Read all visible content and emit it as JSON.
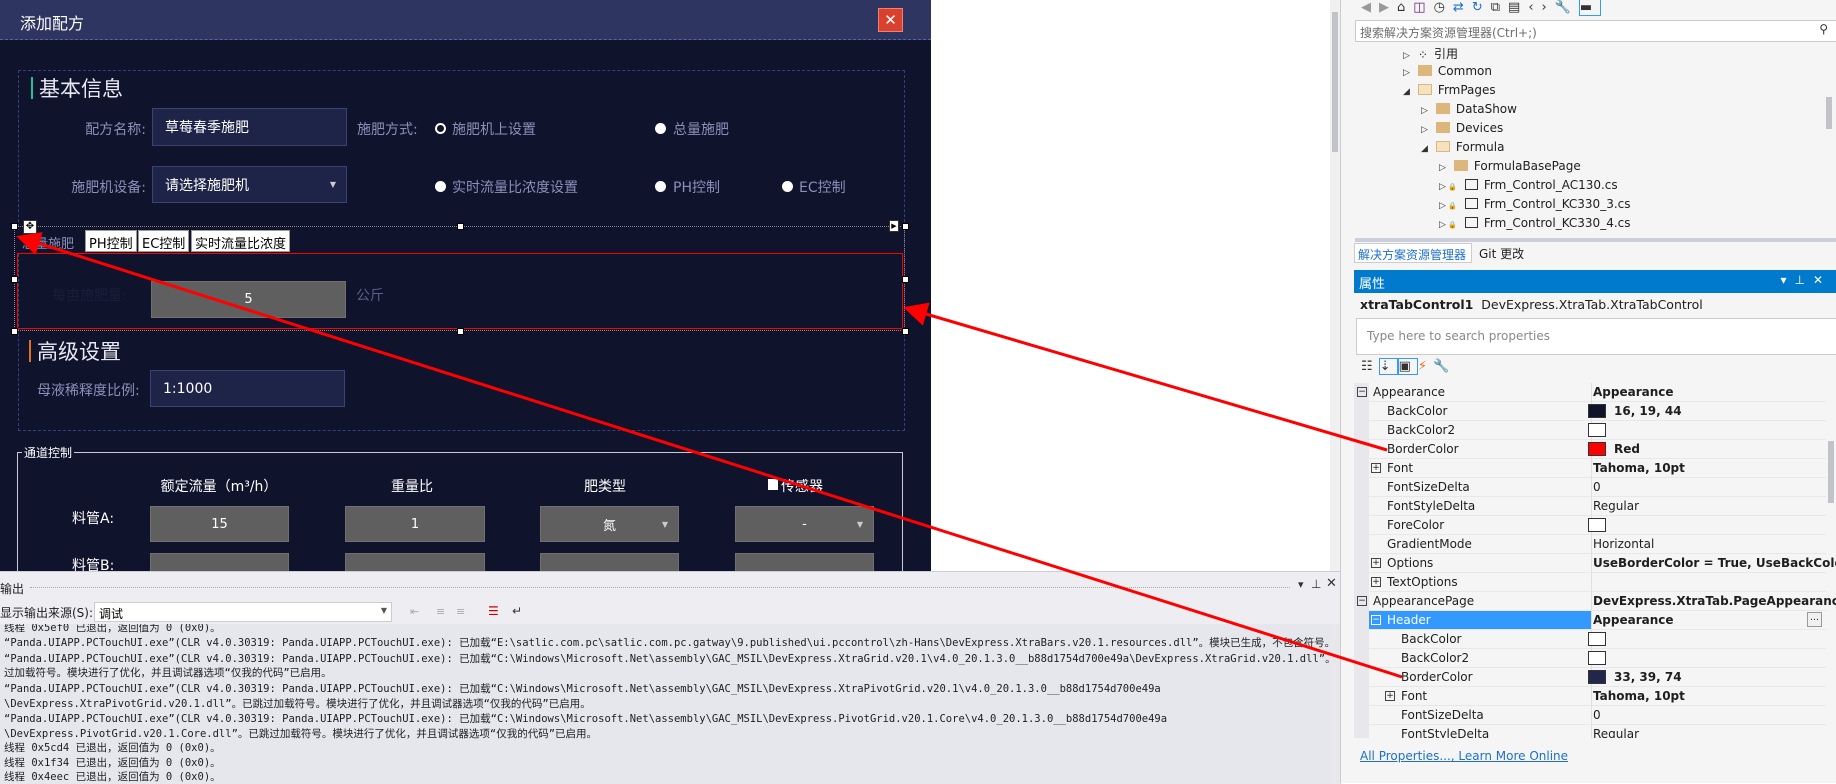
{
  "dialog": {
    "title": "添加配方",
    "close_icon": "close-icon",
    "basic_section": "基本信息",
    "recipe_name_label": "配方名称:",
    "recipe_name_value": "草莓春季施肥",
    "method_label": "施肥方式:",
    "method_options": [
      {
        "label": "施肥机上设置",
        "selected": true
      },
      {
        "label": "总量施肥",
        "selected": false
      }
    ],
    "device_label": "施肥机设备:",
    "device_value": "请选择施肥机",
    "control_options": [
      {
        "label": "实时流量比浓度设置"
      },
      {
        "label": "PH控制"
      },
      {
        "label": "EC控制"
      }
    ],
    "tabs": [
      "总量施肥",
      "PH控制",
      "EC控制",
      "实时流量比浓度"
    ],
    "per_mu_label": "每亩施肥量:",
    "per_mu_value": "5",
    "per_mu_unit": "公斤",
    "advanced_section": "高级设置",
    "dilution_label": "母液稀释度比例:",
    "dilution_value": "1:1000",
    "channel_group": "通道控制",
    "columns": [
      "额定流量（m³/h）",
      "重量比",
      "肥类型",
      "传感器"
    ],
    "rows": [
      {
        "label": "料管A:",
        "flow": "15",
        "ratio": "1",
        "type": "氮",
        "sensor": "-"
      },
      {
        "label": "料管B:"
      }
    ],
    "colors": {
      "background": "#10132c",
      "titlebar": "#2e3560",
      "tab_border": "#ff0000"
    }
  },
  "output": {
    "title": "输出",
    "source_label": "显示输出来源(S):",
    "source_value": "调试",
    "lines": [
      "线程 0x5ef0 已退出，返回值为 0 (0x0)。",
      "“Panda.UIAPP.PCTouchUI.exe”(CLR v4.0.30319: Panda.UIAPP.PCTouchUI.exe): 已加载“E:\\satlic.com.pc\\satlic.com.pc.gatway\\9.published\\ui.pccontrol\\zh-Hans\\DevExpress.XtraBars.v20.1.resources.dll”。模块已生成，不包含符号。",
      "“Panda.UIAPP.PCTouchUI.exe”(CLR v4.0.30319: Panda.UIAPP.PCTouchUI.exe): 已加载“C:\\Windows\\Microsoft.Net\\assembly\\GAC_MSIL\\DevExpress.XtraGrid.v20.1\\v4.0_20.1.3.0__b88d1754d700e49a\\DevExpress.XtraGrid.v20.1.dll”。已跳",
      "  过加载符号。模块进行了优化，并且调试器选项“仅我的代码”已启用。",
      "“Panda.UIAPP.PCTouchUI.exe”(CLR v4.0.30319: Panda.UIAPP.PCTouchUI.exe): 已加载“C:\\Windows\\Microsoft.Net\\assembly\\GAC_MSIL\\DevExpress.XtraPivotGrid.v20.1\\v4.0_20.1.3.0__b88d1754d700e49a",
      "  \\DevExpress.XtraPivotGrid.v20.1.dll”。已跳过加载符号。模块进行了优化，并且调试器选项“仅我的代码”已启用。",
      "“Panda.UIAPP.PCTouchUI.exe”(CLR v4.0.30319: Panda.UIAPP.PCTouchUI.exe): 已加载“C:\\Windows\\Microsoft.Net\\assembly\\GAC_MSIL\\DevExpress.PivotGrid.v20.1.Core\\v4.0_20.1.3.0__b88d1754d700e49a",
      "  \\DevExpress.PivotGrid.v20.1.Core.dll”。已跳过加载符号。模块进行了优化，并且调试器选项“仅我的代码”已启用。",
      "线程 0x5cd4 已退出，返回值为 0 (0x0)。",
      "线程 0x1f34 已退出，返回值为 0 (0x0)。",
      "线程 0x4eec 已退出，返回值为 0 (0x0)。"
    ]
  },
  "solution": {
    "search_placeholder": "搜索解决方案资源管理器(Ctrl+;)",
    "items": [
      {
        "label": "引用",
        "level": 1,
        "expanded": false,
        "icon": "references-icon"
      },
      {
        "label": "Common",
        "level": 1,
        "expanded": false,
        "icon": "folder-icon"
      },
      {
        "label": "FrmPages",
        "level": 1,
        "expanded": true,
        "icon": "folder-open-icon"
      },
      {
        "label": "DataShow",
        "level": 2,
        "expanded": false,
        "icon": "folder-icon"
      },
      {
        "label": "Devices",
        "level": 2,
        "expanded": false,
        "icon": "folder-icon"
      },
      {
        "label": "Formula",
        "level": 2,
        "expanded": true,
        "icon": "folder-open-icon"
      },
      {
        "label": "FormulaBasePage",
        "level": 3,
        "expanded": false,
        "icon": "folder-icon"
      },
      {
        "label": "Frm_Control_AC130.cs",
        "level": 3,
        "expanded": false,
        "icon": "form-icon"
      },
      {
        "label": "Frm_Control_KC330_3.cs",
        "level": 3,
        "expanded": false,
        "icon": "form-icon"
      },
      {
        "label": "Frm_Control_KC330_4.cs",
        "level": 3,
        "expanded": false,
        "icon": "form-icon"
      }
    ],
    "tabs": [
      "解决方案资源管理器",
      "Git 更改"
    ]
  },
  "properties": {
    "title": "属性",
    "object_name": "xtraTabControl1",
    "object_type": "DevExpress.XtraTab.XtraTabControl",
    "search_placeholder": "Type here to search properties",
    "rows": [
      {
        "name": "Appearance",
        "value": "Appearance",
        "level": 0,
        "expander": "minus",
        "bold": true
      },
      {
        "name": "BackColor",
        "value": "16, 19, 44",
        "level": 1,
        "swatch": "#10132c",
        "bold": true
      },
      {
        "name": "BackColor2",
        "value": "",
        "level": 1,
        "swatch": "#ffffff"
      },
      {
        "name": "BorderColor",
        "value": "Red",
        "level": 1,
        "swatch": "#ff0000",
        "bold": true
      },
      {
        "name": "Font",
        "value": "Tahoma, 10pt",
        "level": 1,
        "expander": "plus",
        "bold": true
      },
      {
        "name": "FontSizeDelta",
        "value": "0",
        "level": 1
      },
      {
        "name": "FontStyleDelta",
        "value": "Regular",
        "level": 1
      },
      {
        "name": "ForeColor",
        "value": "",
        "level": 1,
        "swatch": "#ffffff"
      },
      {
        "name": "GradientMode",
        "value": "Horizontal",
        "level": 1
      },
      {
        "name": "Options",
        "value": "UseBorderColor = True, UseBackColor",
        "level": 1,
        "expander": "plus",
        "bold": true
      },
      {
        "name": "TextOptions",
        "value": "",
        "level": 1,
        "expander": "plus"
      },
      {
        "name": "AppearancePage",
        "value": "DevExpress.XtraTab.PageAppearance",
        "level": 0,
        "expander": "minus",
        "bold": true
      },
      {
        "name": "Header",
        "value": "Appearance",
        "level": 1,
        "expander": "minus",
        "bold": true,
        "selected": true
      },
      {
        "name": "BackColor",
        "value": "",
        "level": 2,
        "swatch": "#ffffff"
      },
      {
        "name": "BackColor2",
        "value": "",
        "level": 2,
        "swatch": "#ffffff"
      },
      {
        "name": "BorderColor",
        "value": "33, 39, 74",
        "level": 2,
        "swatch": "#21274a",
        "bold": true
      },
      {
        "name": "Font",
        "value": "Tahoma, 10pt",
        "level": 2,
        "expander": "plus",
        "bold": true
      },
      {
        "name": "FontSizeDelta",
        "value": "0",
        "level": 2
      },
      {
        "name": "FontStyleDelta",
        "value": "Regular",
        "level": 2
      }
    ],
    "links": [
      "All Properties...",
      "Learn More Online"
    ],
    "header_color": "#007acc",
    "selected_color": "#3399ff"
  }
}
